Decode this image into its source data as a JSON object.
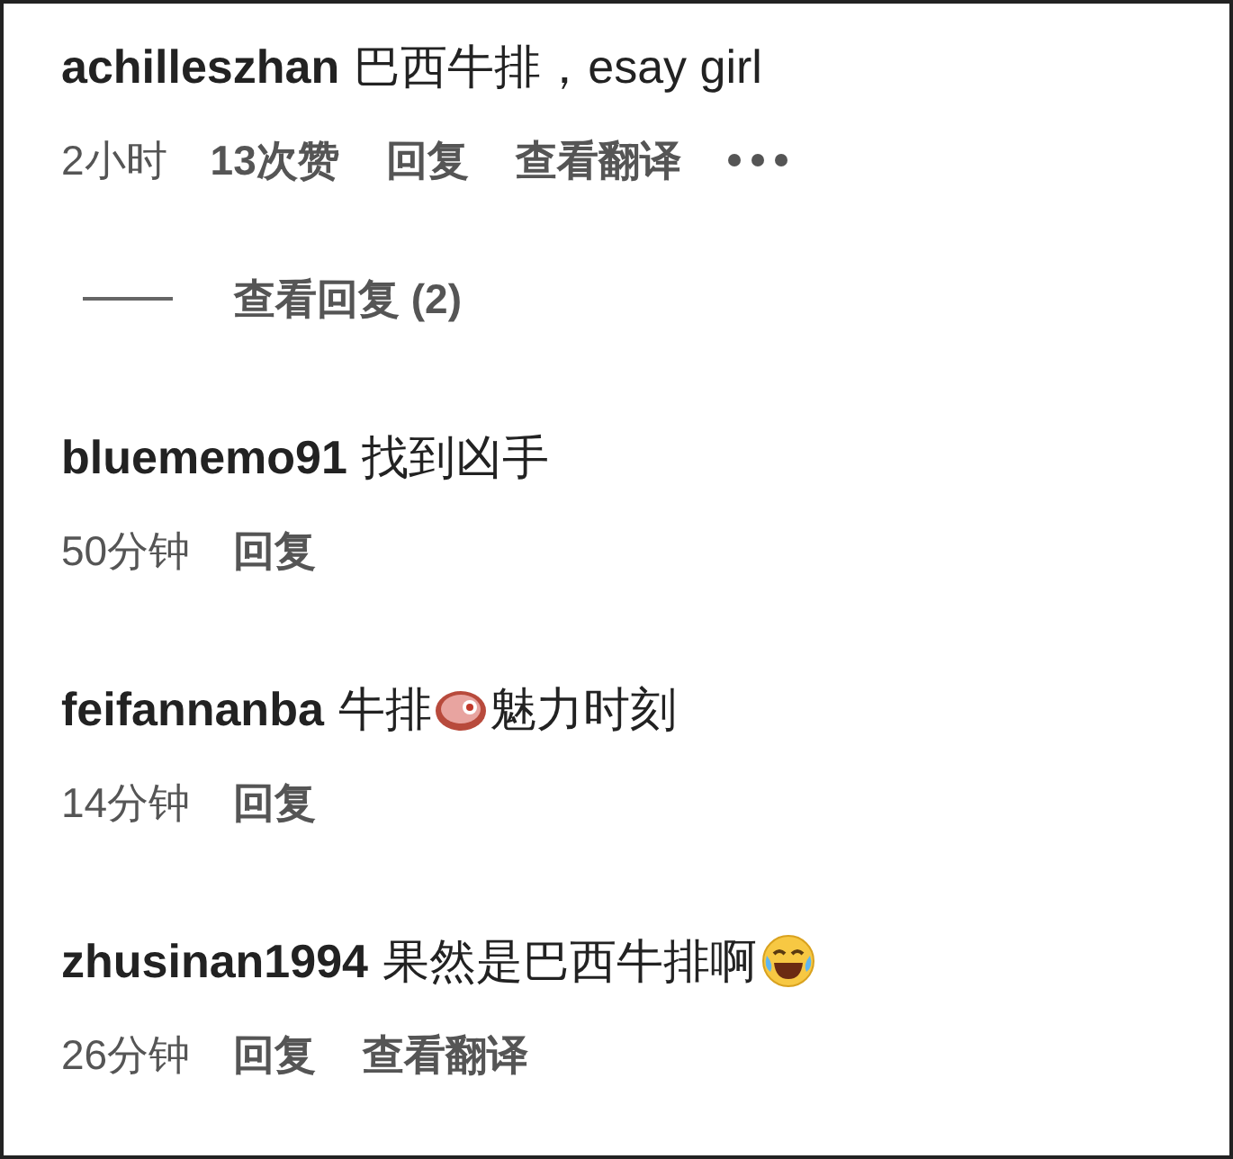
{
  "comments": [
    {
      "user": "achilleszhan",
      "content": [
        {
          "kind": "text",
          "text": "巴西牛排，esay girl"
        }
      ],
      "meta": [
        {
          "kind": "time",
          "text": "2小时"
        },
        {
          "kind": "likes",
          "text": "13次赞"
        },
        {
          "kind": "reply",
          "text": "回复"
        },
        {
          "kind": "translate",
          "text": "查看翻译"
        },
        {
          "kind": "more"
        }
      ],
      "replies": {
        "label": "查看回复 (2)"
      }
    },
    {
      "user": "bluememo91",
      "content": [
        {
          "kind": "text",
          "text": "找到凶手"
        }
      ],
      "meta": [
        {
          "kind": "time",
          "text": "50分钟"
        },
        {
          "kind": "reply",
          "text": "回复"
        }
      ]
    },
    {
      "user": "feifannanba",
      "content": [
        {
          "kind": "text",
          "text": "牛排"
        },
        {
          "kind": "steak"
        },
        {
          "kind": "text",
          "text": "魅力时刻"
        }
      ],
      "meta": [
        {
          "kind": "time",
          "text": "14分钟"
        },
        {
          "kind": "reply",
          "text": "回复"
        }
      ]
    },
    {
      "user": "zhusinan1994",
      "content": [
        {
          "kind": "text",
          "text": "果然是巴西牛排啊"
        },
        {
          "kind": "laugh"
        }
      ],
      "meta": [
        {
          "kind": "time",
          "text": "26分钟"
        },
        {
          "kind": "reply",
          "text": "回复"
        },
        {
          "kind": "translate",
          "text": "查看翻译"
        }
      ]
    }
  ]
}
